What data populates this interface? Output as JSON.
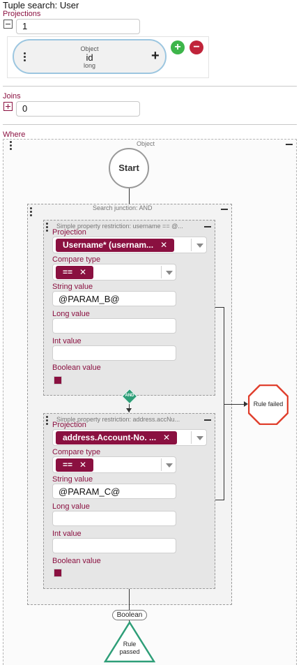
{
  "page": {
    "title": "Tuple search: User"
  },
  "projections": {
    "label": "Projections",
    "count": "1",
    "items": [
      {
        "type": "Object",
        "name": "id",
        "datatype": "long"
      }
    ]
  },
  "joins": {
    "label": "Joins",
    "count": "0"
  },
  "where": {
    "label": "Where",
    "object_label": "Object",
    "start_label": "Start",
    "junction_label": "Search junction: AND",
    "and_label": "AND",
    "restrictions": [
      {
        "header": "Simple property restriction: username == @...",
        "projection_label": "Projection",
        "projection_value": "Username* (usernam...",
        "compare_label": "Compare type",
        "compare_value": "==",
        "string_label": "String value",
        "string_value": "@PARAM_B@",
        "long_label": "Long value",
        "long_value": "",
        "int_label": "Int value",
        "int_value": "",
        "boolean_label": "Boolean value"
      },
      {
        "header": "Simple property restriction: address.accNu...",
        "projection_label": "Projection",
        "projection_value": "address.Account-No. ...",
        "compare_label": "Compare type",
        "compare_value": "==",
        "string_label": "String value",
        "string_value": "@PARAM_C@",
        "long_label": "Long value",
        "long_value": "",
        "int_label": "Int value",
        "int_value": "",
        "boolean_label": "Boolean value"
      }
    ],
    "rule_failed_label": "Rule failed",
    "boolean_label": "Boolean",
    "rule_passed_label": "Rule passed"
  },
  "colors": {
    "accent": "#8a1040",
    "add": "#3db54a",
    "remove": "#c0243a",
    "failed": "#e0402e",
    "passed": "#2e9e78",
    "card_border": "#9cc6e0"
  },
  "icons": [
    "collapse-icon",
    "expand-icon",
    "drag-handle-icon",
    "plus-icon",
    "add-circle-icon",
    "remove-circle-icon",
    "minimize-icon",
    "clear-icon",
    "dropdown-caret-icon"
  ]
}
